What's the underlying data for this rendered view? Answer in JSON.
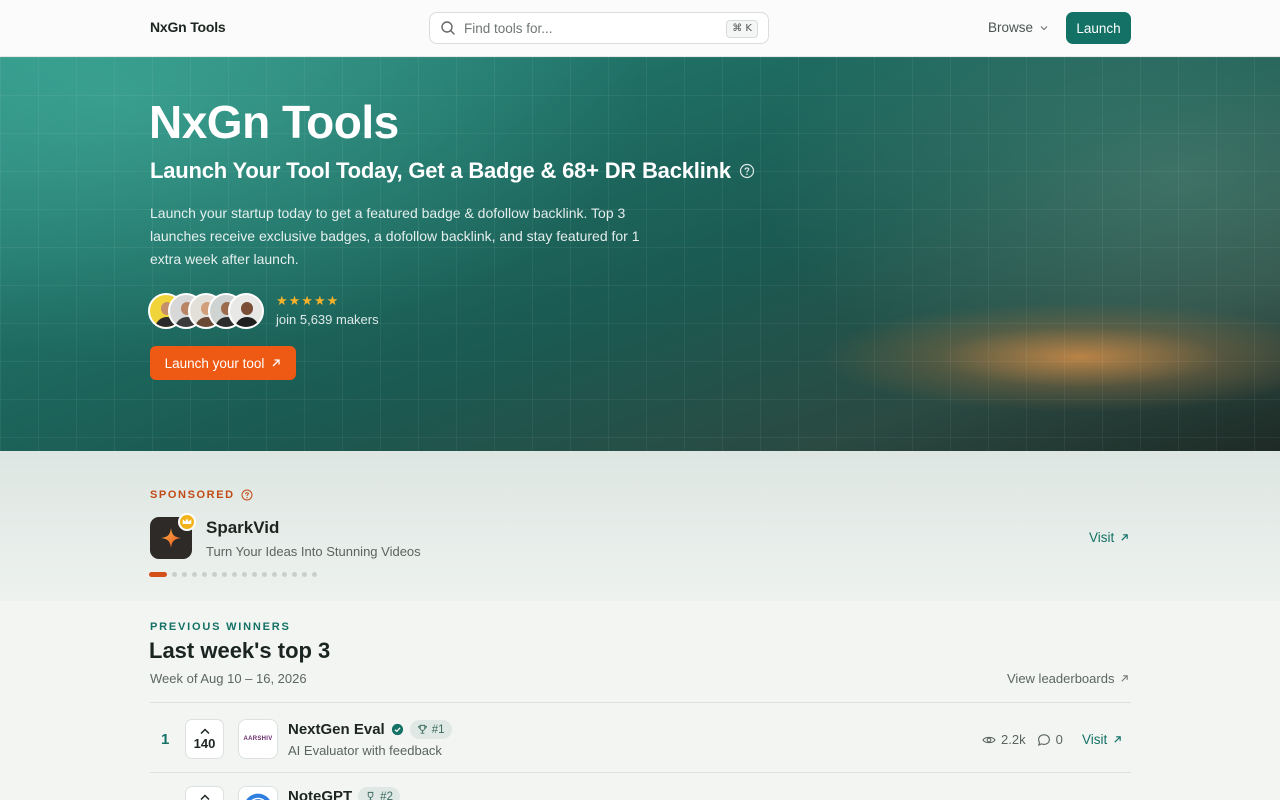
{
  "header": {
    "logo": "NxGn Tools",
    "search_placeholder": "Find tools for...",
    "search_shortcut": "⌘ K",
    "browse_label": "Browse",
    "launch_label": "Launch"
  },
  "hero": {
    "title": "NxGn Tools",
    "subtitle": "Launch Your Tool Today, Get a Badge & 68+ DR Backlink",
    "description": "Launch your startup today to get a featured badge & dofollow backlink. Top 3 launches receive exclusive badges, a dofollow backlink, and stay featured for 1 extra week after launch.",
    "stars": "★★★★★",
    "makers_text": "join 5,639 makers",
    "cta_label": "Launch your tool"
  },
  "sponsored": {
    "label": "SPONSORED",
    "name": "SparkVid",
    "tagline": "Turn Your Ideas Into Stunning Videos",
    "visit_label": "Visit",
    "slide_count": 16,
    "active_slide": 0
  },
  "winners": {
    "label": "PREVIOUS WINNERS",
    "title": "Last week's top 3",
    "week": "Week of Aug 10 – 16, 2026",
    "leaderboard_link": "View leaderboards",
    "items": [
      {
        "rank": "1",
        "votes": "140",
        "logo_text": "AARSHIV",
        "name": "NextGen Eval",
        "badge": "#1",
        "description": "AI Evaluator with feedback",
        "views": "2.2k",
        "comments": "0",
        "visit_label": "Visit"
      },
      {
        "rank": "",
        "votes": "",
        "logo_text": "",
        "name": "NoteGPT",
        "badge": "#2",
        "description": "",
        "views": "",
        "comments": "",
        "visit_label": ""
      }
    ]
  },
  "colors": {
    "brand": "#137165",
    "cta": "#ee5a14",
    "sponsored": "#c24a15",
    "star": "#f4b12a"
  }
}
